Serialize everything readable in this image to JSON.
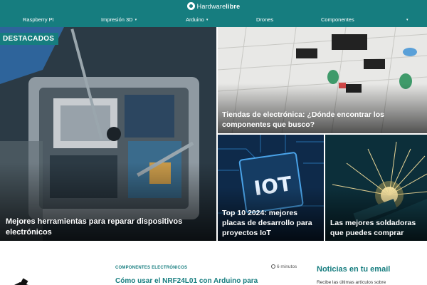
{
  "header": {
    "logo_light": "Hardware",
    "logo_bold": "libre",
    "nav": [
      {
        "label": "Raspberry PI",
        "dropdown": false
      },
      {
        "label": "Impresión 3D",
        "dropdown": true
      },
      {
        "label": "Arduino",
        "dropdown": true
      },
      {
        "label": "Drones",
        "dropdown": false
      },
      {
        "label": "Componentes",
        "dropdown": false
      },
      {
        "label": "",
        "dropdown": true
      }
    ],
    "caret": "▾"
  },
  "hero": {
    "badge": "DESTACADOS",
    "tiles": [
      {
        "title": "Mejores herramientas para reparar dispositivos electrónicos"
      },
      {
        "title": "Tiendas de electrónica: ¿Dónde encontrar los componentes que busco?"
      },
      {
        "title": "Top 10 2024: mejores placas de desarrollo para proyectos IoT",
        "image_text": "IOT"
      },
      {
        "title": "Las mejores soldadoras que puedes comprar"
      }
    ]
  },
  "article": {
    "category": "COMPONENTES ELECTRÓNICOS",
    "read_time": "6 minutos",
    "title": "Cómo usar el NRF24L01 con Arduino para"
  },
  "sidebar": {
    "title": "Noticias en tu email",
    "text": "Recibe las últimas artículos sobre"
  },
  "colors": {
    "brand": "#167d7f"
  }
}
